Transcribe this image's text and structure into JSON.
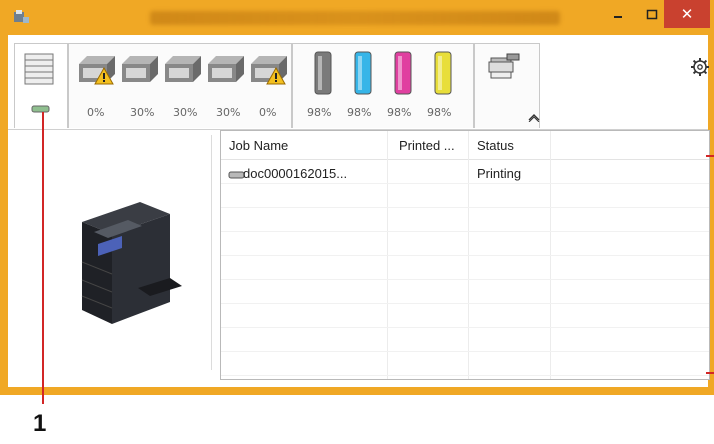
{
  "window": {
    "title": "",
    "close_symbol": "✕"
  },
  "toner_tabs": [
    {
      "kind": "waste",
      "pct": "0%",
      "warning": true
    },
    {
      "kind": "drum",
      "pct": "30%",
      "warning": false
    },
    {
      "kind": "drum",
      "pct": "30%",
      "warning": false
    },
    {
      "kind": "drum",
      "pct": "30%",
      "warning": false
    },
    {
      "kind": "drum",
      "pct": "0%",
      "warning": true
    }
  ],
  "ink_tabs": [
    {
      "color": "#7a7a7a",
      "pct": "98%"
    },
    {
      "color": "#36b5e8",
      "pct": "98%"
    },
    {
      "color": "#e040a0",
      "pct": "98%"
    },
    {
      "color": "#e8de3a",
      "pct": "98%"
    }
  ],
  "table": {
    "columns": [
      "Job Name",
      "Printed ...",
      "Status"
    ],
    "rows": [
      {
        "job": "doc0000162015...",
        "printed": "",
        "status": "Printing"
      }
    ]
  },
  "annotation": {
    "number": "1"
  },
  "icons": [
    "printer-app-icon",
    "minimize-icon",
    "maximize-icon",
    "close-icon",
    "job-list-icon",
    "settings-gear-icon",
    "collapse-icon",
    "scanner-icon",
    "printer-image"
  ]
}
